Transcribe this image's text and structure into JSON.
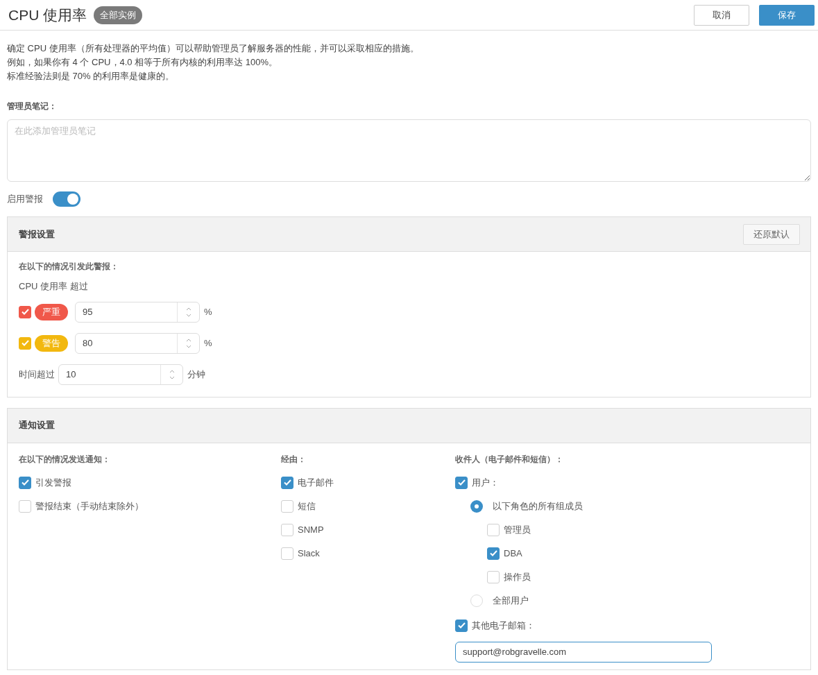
{
  "header": {
    "title": "CPU 使用率",
    "badge": "全部实例",
    "buttons": [
      {
        "label": "取消",
        "kind": "secondary"
      },
      {
        "label": "保存",
        "kind": "primary"
      }
    ]
  },
  "description": [
    "确定 CPU 使用率（所有处理器的平均值）可以帮助管理员了解服务器的性能，并可以采取相应的措施。",
    "例如，如果你有 4 个 CPU，4.0 相等于所有内核的利用率达 100%。",
    "标准经验法则是 70% 的利用率是健康的。"
  ],
  "notes": {
    "label": "管理员笔记：",
    "placeholder": "在此添加管理员笔记"
  },
  "enable_alerts": {
    "label": "启用警报",
    "on": true
  },
  "alert_settings": {
    "title": "警报设置",
    "reset_button": "还原默认",
    "trigger_label": "在以下的情况引发此警报：",
    "metric_label": "CPU 使用率 超过",
    "thresholds": [
      {
        "checked": true,
        "label": "严重",
        "color": "#f0584a",
        "value": "95",
        "unit": "%"
      },
      {
        "checked": true,
        "label": "警告",
        "color": "#f2b80f",
        "value": "80",
        "unit": "%"
      }
    ],
    "duration": {
      "label": "时间超过",
      "value": "10",
      "unit": "分钟"
    }
  },
  "notification_settings": {
    "title": "通知设置",
    "conditions": {
      "heading": "在以下的情况发送通知：",
      "options": [
        {
          "label": "引发警报",
          "checked": true
        },
        {
          "label": "警报结束（手动结束除外）",
          "checked": false
        }
      ]
    },
    "via": {
      "heading": "经由：",
      "options": [
        {
          "label": "电子邮件",
          "checked": true
        },
        {
          "label": "短信",
          "checked": false
        },
        {
          "label": "SNMP",
          "checked": false
        },
        {
          "label": "Slack",
          "checked": false
        }
      ]
    },
    "recipients": {
      "heading": "收件人（电子邮件和短信）：",
      "users": {
        "label": "用户：",
        "checked": true
      },
      "modes": [
        {
          "label": "以下角色的所有组成员",
          "selected": true,
          "children": [
            {
              "label": "管理员",
              "checked": false
            },
            {
              "label": "DBA",
              "checked": true
            },
            {
              "label": "操作员",
              "checked": false
            }
          ]
        },
        {
          "label": "全部用户",
          "selected": false
        }
      ],
      "other_emails": {
        "label": "其他电子邮箱：",
        "checked": true,
        "value": "support@robgravelle.com"
      }
    }
  }
}
